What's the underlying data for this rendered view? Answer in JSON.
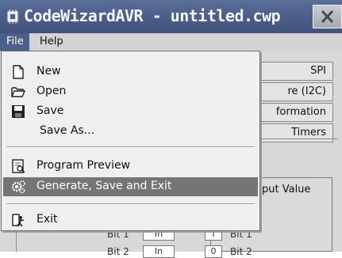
{
  "window": {
    "title": "CodeWizardAVR - untitled.cwp"
  },
  "menubar": {
    "file": "File",
    "help": "Help"
  },
  "tabs": [
    {
      "label": "SPI"
    },
    {
      "label": "re (I2C)"
    },
    {
      "label": "formation"
    },
    {
      "label": "Timers"
    }
  ],
  "panel": {
    "group_label": "put Value",
    "rows": [
      {
        "left": "Bit 1",
        "combo": "In",
        "value": "T",
        "right": "Bit 1"
      },
      {
        "left": "Bit 2",
        "combo": "In",
        "value": "0",
        "right": "Bit 2"
      }
    ]
  },
  "file_menu": {
    "items": [
      {
        "label": "New",
        "icon": "new-file-icon"
      },
      {
        "label": "Open",
        "icon": "open-folder-icon"
      },
      {
        "label": "Save",
        "icon": "save-disk-icon"
      },
      {
        "label": "Save As...",
        "icon": ""
      },
      {
        "label": "Program Preview",
        "icon": "program-preview-icon"
      },
      {
        "label": "Generate, Save and Exit",
        "icon": "gears-icon"
      },
      {
        "label": "Exit",
        "icon": "exit-icon"
      }
    ],
    "selected": "Generate, Save and Exit"
  },
  "colors": {
    "titlebar": "#4b5f8a",
    "selection": "#757575",
    "menu_background": "#efefef"
  }
}
